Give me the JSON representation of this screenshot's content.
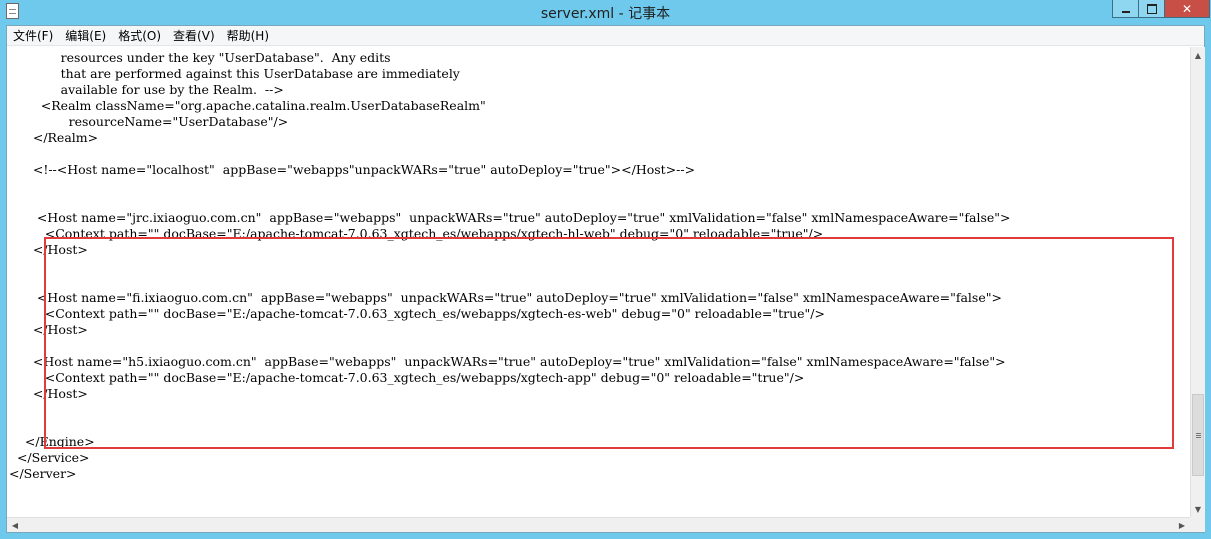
{
  "window": {
    "title": "server.xml - 记事本",
    "app_icon": "notepad-icon",
    "controls": {
      "close_glyph": "✕"
    }
  },
  "menu": [
    {
      "label": "文件(F)"
    },
    {
      "label": "编辑(E)"
    },
    {
      "label": "格式(O)"
    },
    {
      "label": "查看(V)"
    },
    {
      "label": "帮助(H)"
    }
  ],
  "editor": {
    "lines": [
      "             resources under the key \"UserDatabase\".  Any edits",
      "             that are performed against this UserDatabase are immediately",
      "             available for use by the Realm.  -->",
      "        <Realm className=\"org.apache.catalina.realm.UserDatabaseRealm\"",
      "               resourceName=\"UserDatabase\"/>",
      "      </Realm>",
      "",
      "      <!--<Host name=\"localhost\"  appBase=\"webapps\"unpackWARs=\"true\" autoDeploy=\"true\"></Host>-->",
      "",
      "",
      "       <Host name=\"jrc.ixiaoguo.com.cn\"  appBase=\"webapps\"  unpackWARs=\"true\" autoDeploy=\"true\" xmlValidation=\"false\" xmlNamespaceAware=\"false\">",
      "         <Context path=\"\" docBase=\"E:/apache-tomcat-7.0.63_xgtech_es/webapps/xgtech-hl-web\" debug=\"0\" reloadable=\"true\"/>",
      "      </Host>",
      "",
      "",
      "       <Host name=\"fi.ixiaoguo.com.cn\"  appBase=\"webapps\"  unpackWARs=\"true\" autoDeploy=\"true\" xmlValidation=\"false\" xmlNamespaceAware=\"false\">",
      "         <Context path=\"\" docBase=\"E:/apache-tomcat-7.0.63_xgtech_es/webapps/xgtech-es-web\" debug=\"0\" reloadable=\"true\"/>",
      "      </Host>",
      "",
      "      <Host name=\"h5.ixiaoguo.com.cn\"  appBase=\"webapps\"  unpackWARs=\"true\" autoDeploy=\"true\" xmlValidation=\"false\" xmlNamespaceAware=\"false\">",
      "         <Context path=\"\" docBase=\"E:/apache-tomcat-7.0.63_xgtech_es/webapps/xgtech-app\" debug=\"0\" reloadable=\"true\"/>",
      "      </Host>",
      "",
      "",
      "    </Engine>",
      "  </Service>",
      "</Server>"
    ]
  },
  "annotation": {
    "color": "#e03a3a"
  },
  "scrollbars": {
    "vertical_position": 0.93,
    "arrow_up": "▲",
    "arrow_down": "▼",
    "arrow_left": "◀",
    "arrow_right": "▶"
  }
}
